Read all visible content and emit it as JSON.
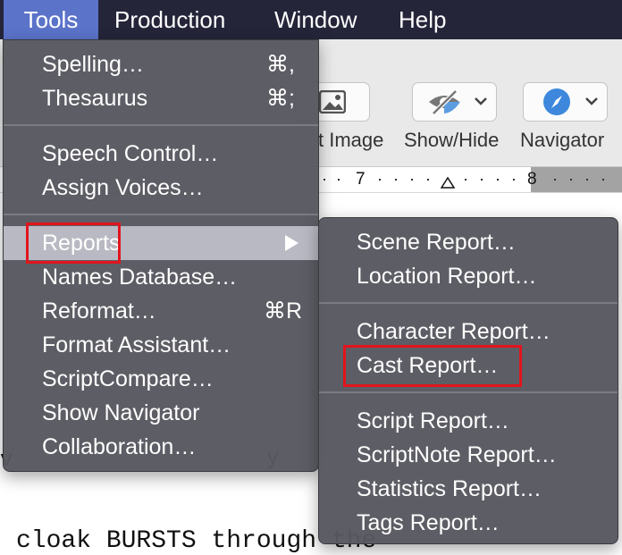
{
  "menubar": {
    "items": [
      "Tools",
      "Production",
      "Window",
      "Help"
    ],
    "active": "Tools"
  },
  "toolbar": {
    "labels": [
      "t Image",
      "Show/Hide",
      "Navigator"
    ],
    "icons": [
      "insert-image-icon",
      "show-hide-eye-icon",
      "navigator-compass-icon"
    ]
  },
  "ruler": {
    "marks": [
      "7",
      "8"
    ]
  },
  "document": {
    "line": "cloak BURSTS through the",
    "fragment_left": "v",
    "fragment_mid": "y"
  },
  "tools_menu": {
    "spelling": {
      "label": "Spelling…",
      "shortcut": "⌘,"
    },
    "thesaurus": {
      "label": "Thesaurus",
      "shortcut": "⌘;"
    },
    "speech_control": {
      "label": "Speech Control…"
    },
    "assign_voices": {
      "label": "Assign Voices…"
    },
    "reports": {
      "label": "Reports",
      "arrow": "▶"
    },
    "names_database": {
      "label": "Names Database…"
    },
    "reformat": {
      "label": "Reformat…",
      "shortcut": "⌘R"
    },
    "format_assistant": {
      "label": "Format Assistant…"
    },
    "scriptcompare": {
      "label": "ScriptCompare…"
    },
    "show_navigator": {
      "label": "Show Navigator"
    },
    "collaboration": {
      "label": "Collaboration…"
    }
  },
  "reports_menu": {
    "scene": "Scene Report…",
    "location": "Location Report…",
    "character": "Character Report…",
    "cast": "Cast Report…",
    "script": "Script Report…",
    "scriptnote": "ScriptNote Report…",
    "statistics": "Statistics Report…",
    "tags": "Tags Report…"
  },
  "colors": {
    "menubar_bg": "#25253a",
    "menubar_active": "#5b73c9",
    "menu_bg": "#58585f",
    "highlight": "#b9b9c3",
    "annotation_red": "#e2141c"
  }
}
